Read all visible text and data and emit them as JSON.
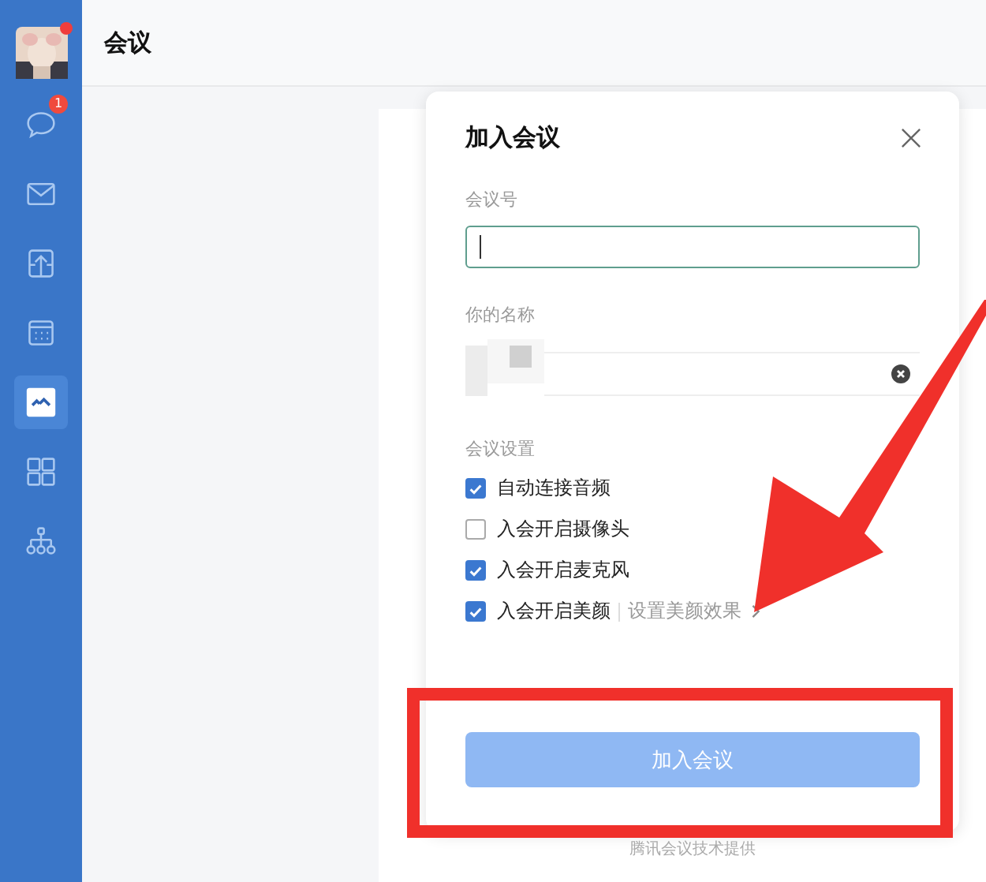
{
  "header": {
    "title": "会议"
  },
  "sidebar": {
    "avatar_dot": true,
    "items": [
      {
        "kind": "chat",
        "selected": false,
        "badge": "1"
      },
      {
        "kind": "mail",
        "selected": false
      },
      {
        "kind": "box",
        "selected": false
      },
      {
        "kind": "calendar",
        "selected": false
      },
      {
        "kind": "meeting",
        "selected": true
      },
      {
        "kind": "apps",
        "selected": false
      },
      {
        "kind": "org",
        "selected": false
      }
    ]
  },
  "dialog": {
    "title": "加入会议",
    "meeting_id": {
      "label": "会议号",
      "focused": true
    },
    "name": {
      "label": "你的名称"
    },
    "settings_label": "会议设置",
    "options": [
      {
        "label": "自动连接音频",
        "checked": true
      },
      {
        "label": "入会开启摄像头",
        "checked": false
      },
      {
        "label": "入会开启麦克风",
        "checked": true
      },
      {
        "label": "入会开启美颜",
        "checked": true,
        "link": "设置美颜效果"
      }
    ],
    "join_button": {
      "label": "加入会议",
      "disabled": true
    }
  },
  "footer": "腾讯会议技术提供"
}
